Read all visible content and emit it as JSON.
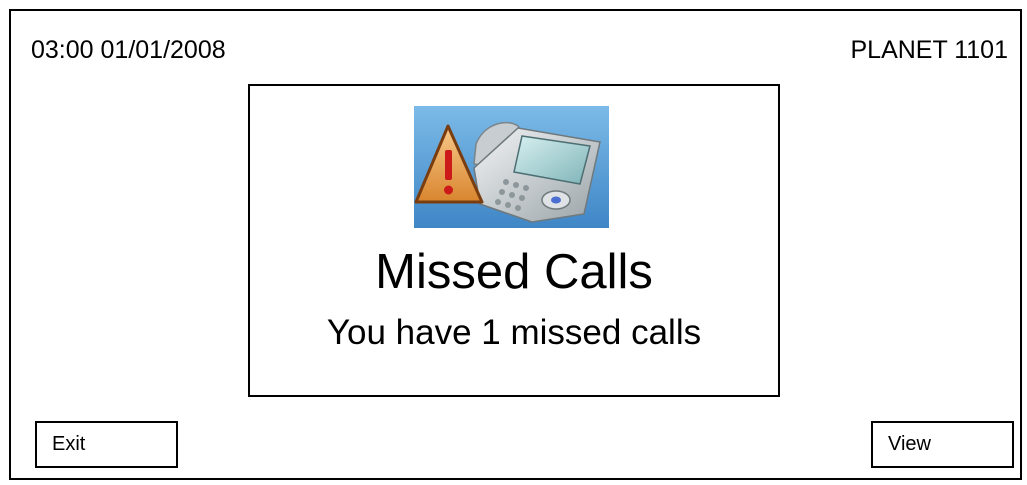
{
  "status_bar": {
    "datetime": "03:00 01/01/2008",
    "model": "PLANET 1101"
  },
  "dialog": {
    "icon": "missed-call-warning-phone-icon",
    "title": "Missed Calls",
    "message": "You have 1 missed calls"
  },
  "softkeys": {
    "left_label": "Exit",
    "right_label": "View"
  },
  "colors": {
    "icon_background": "#5a9ed6",
    "warning_triangle": "#e8a04a",
    "warning_mark": "#cc1a1a"
  }
}
